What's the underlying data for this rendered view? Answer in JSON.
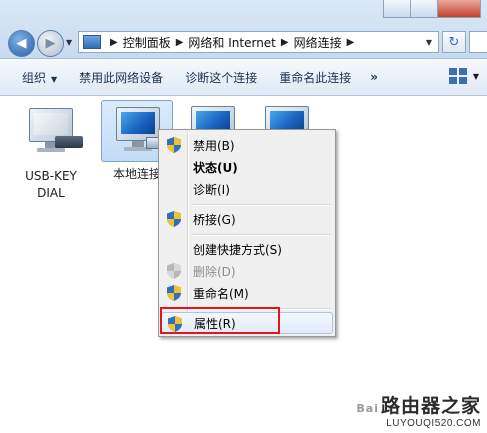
{
  "address": {
    "crumbs": [
      "控制面板",
      "网络和 Internet",
      "网络连接"
    ]
  },
  "toolbar": {
    "organize": "组织",
    "disable_device": "禁用此网络设备",
    "diagnose": "诊断这个连接",
    "rename": "重命名此连接",
    "more": "»"
  },
  "connections": [
    {
      "label_line1": "USB-KEY",
      "label_line2": "DIAL",
      "icon": "modem-computer-icon"
    },
    {
      "label_line1": "本地连接",
      "icon": "network-computer-icon",
      "selected": true
    },
    {
      "icon": "network-computer-icon"
    },
    {
      "icon": "network-computer-icon"
    }
  ],
  "context_menu": {
    "items": [
      {
        "label": "禁用(B)"
      },
      {
        "label": "状态(U)"
      },
      {
        "label": "诊断(I)"
      },
      {
        "label": "桥接(G)"
      },
      {
        "label": "创建快捷方式(S)"
      },
      {
        "label": "删除(D)"
      },
      {
        "label": "重命名(M)"
      },
      {
        "label": "属性(R)"
      }
    ]
  },
  "watermark": {
    "main": "路由器之家",
    "url": "LUYOUQI520.COM",
    "small": "Bai"
  },
  "colors": {
    "highlight_box": "#e5141b",
    "selection": "#c1dcf7",
    "shield_blue": "#2c6fc5",
    "shield_yellow": "#f2c12e"
  }
}
